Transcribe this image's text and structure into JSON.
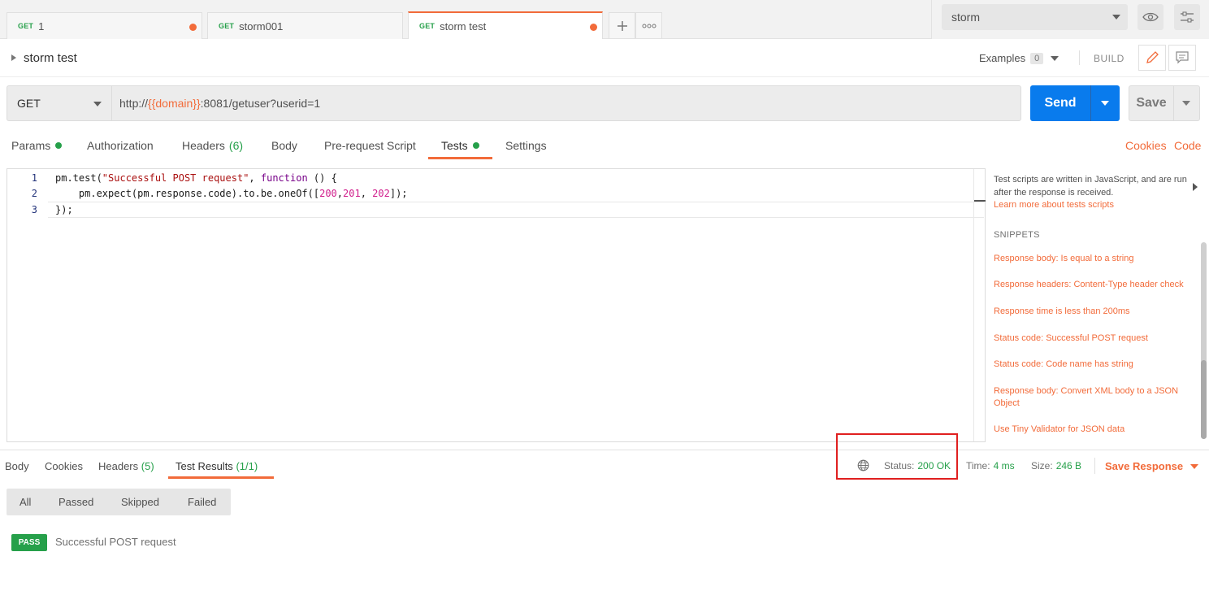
{
  "tabs": [
    {
      "method": "GET",
      "name": "1",
      "unsaved": true
    },
    {
      "method": "GET",
      "name": "storm001",
      "unsaved": false
    },
    {
      "method": "GET",
      "name": "storm test",
      "unsaved": true,
      "active": true
    }
  ],
  "tab_actions": {
    "add_icon": "plus-icon",
    "more_icon": "ellipsis-icon"
  },
  "environment": {
    "selected": "storm",
    "icons": [
      "eye-icon",
      "sliders-icon"
    ]
  },
  "request": {
    "title": "storm test",
    "examples_label": "Examples",
    "examples_count": "0",
    "build_label": "BUILD",
    "method": "GET",
    "url_prefix": "http://",
    "url_variable": "{{domain}}",
    "url_suffix": ":8081/getuser?userid=1",
    "send_label": "Send",
    "save_label": "Save"
  },
  "request_tabs": [
    {
      "label": "Params",
      "dot": true
    },
    {
      "label": "Authorization"
    },
    {
      "label": "Headers",
      "count": "(6)"
    },
    {
      "label": "Body"
    },
    {
      "label": "Pre-request Script"
    },
    {
      "label": "Tests",
      "dot": true,
      "active": true
    },
    {
      "label": "Settings"
    }
  ],
  "request_links": {
    "cookies": "Cookies",
    "code": "Code"
  },
  "editor": {
    "line_numbers": [
      "1",
      "2",
      "3"
    ],
    "lines": [
      "pm.test(\"Successful POST request\", function () {",
      "    pm.expect(pm.response.code).to.be.oneOf([200,201, 202]);",
      "});"
    ]
  },
  "snippets": {
    "intro": "Test scripts are written in JavaScript, and are run after the response is received.",
    "learn_more": "Learn more about tests scripts",
    "heading": "SNIPPETS",
    "items": [
      "Response body: Is equal to a string",
      "Response headers: Content-Type header check",
      "Response time is less than 200ms",
      "Status code: Successful POST request",
      "Status code: Code name has string",
      "Response body: Convert XML body to a JSON Object",
      "Use Tiny Validator for JSON data"
    ]
  },
  "response": {
    "tabs": [
      {
        "label": "Body"
      },
      {
        "label": "Cookies"
      },
      {
        "label": "Headers",
        "count": "(5)"
      },
      {
        "label": "Test Results",
        "count": "(1/1)",
        "active": true
      }
    ],
    "status_label": "Status:",
    "status_value": "200 OK",
    "time_label": "Time:",
    "time_value": "4 ms",
    "size_label": "Size:",
    "size_value": "246 B",
    "save_label": "Save Response",
    "filters": [
      "All",
      "Passed",
      "Skipped",
      "Failed"
    ],
    "results": [
      {
        "badge": "PASS",
        "name": "Successful POST request"
      }
    ]
  },
  "colors": {
    "accent": "#f26b3a",
    "send": "#097bed",
    "success": "#26a04a",
    "highlight_box": "#e02020"
  }
}
